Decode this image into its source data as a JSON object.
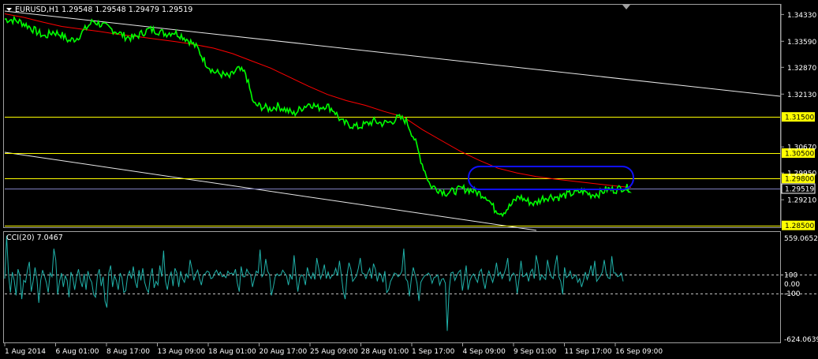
{
  "window": {
    "header": "EURUSD,H1  1.29548 1.29548 1.29479 1.29519",
    "cci_header": "CCI(20) 7.0467"
  },
  "colors": {
    "background": "#000000",
    "frame": "#a0a0a0",
    "price": "#00ff00",
    "ma": "#ff0000",
    "trend": "#e8e8e8",
    "hline": "#ffff00",
    "bid": "#8080c0",
    "highlight": "#1010ff",
    "cci": "#20b2aa",
    "label_bg": "#ffff00",
    "label_text": "#000000",
    "axis_text": "#ffffff"
  },
  "chart_data": [
    {
      "type": "line",
      "title": "EURUSD,H1",
      "ylim": [
        1.2845,
        1.346
      ],
      "y_ticks": [
        "1.34330",
        "1.33590",
        "1.32870",
        "1.32130",
        "1.30670",
        "1.29950",
        "1.29210"
      ],
      "price_labels": [
        "1.31500",
        "1.30500",
        "1.29800",
        "1.29519",
        "1.28500"
      ],
      "x_labels": [
        "1 Aug 2014",
        "6 Aug 01:00",
        "8 Aug 17:00",
        "13 Aug 09:00",
        "18 Aug 01:00",
        "20 Aug 17:00",
        "25 Aug 09:00",
        "28 Aug 01:00",
        "1 Sep 17:00",
        "4 Sep 09:00",
        "9 Sep 01:00",
        "11 Sep 17:00",
        "16 Sep 09:00"
      ],
      "series": [
        {
          "kind": "price",
          "values": [
            1.342,
            1.3418,
            1.3412,
            1.34,
            1.3385,
            1.3372,
            1.3385,
            1.3378,
            1.336,
            1.3368,
            1.3392,
            1.3415,
            1.3405,
            1.3395,
            1.3385,
            1.3372,
            1.3368,
            1.338,
            1.3392,
            1.3388,
            1.338,
            1.3385,
            1.3375,
            1.336,
            1.334,
            1.33,
            1.3275,
            1.3268,
            1.326,
            1.3282,
            1.327,
            1.3185,
            1.3178,
            1.3172,
            1.318,
            1.317,
            1.3158,
            1.3175,
            1.3188,
            1.3175,
            1.3182,
            1.3168,
            1.3135,
            1.3128,
            1.3122,
            1.313,
            1.3138,
            1.3132,
            1.3135,
            1.3148,
            1.314,
            1.309,
            1.302,
            1.296,
            1.295,
            1.294,
            1.2945,
            1.2952,
            1.2948,
            1.294,
            1.293,
            1.2895,
            1.2885,
            1.2905,
            1.293,
            1.2918,
            1.291,
            1.2925,
            1.293,
            1.2928,
            1.2935,
            1.294,
            1.2945,
            1.2935,
            1.2938,
            1.295,
            1.2948,
            1.2955,
            1.2952
          ]
        },
        {
          "kind": "moving-average",
          "values": [
            1.3435,
            1.3425,
            1.3412,
            1.34,
            1.3393,
            1.3386,
            1.3378,
            1.3372,
            1.3365,
            1.3358,
            1.335,
            1.334,
            1.3325,
            1.3305,
            1.3285,
            1.326,
            1.3235,
            1.3212,
            1.3195,
            1.3182,
            1.3165,
            1.315,
            1.3115,
            1.3085,
            1.3055,
            1.303,
            1.3008,
            1.2995,
            1.2985,
            1.2978,
            1.2972,
            1.2966,
            1.296,
            1.2955
          ]
        },
        {
          "kind": "horizontal-levels",
          "values": [
            1.315,
            1.305,
            1.298,
            1.285
          ]
        },
        {
          "kind": "bid",
          "values": [
            1.29519
          ]
        }
      ]
    },
    {
      "type": "line",
      "title": "CCI(20) 7.0467",
      "ylim": [
        -624.0639,
        559.0652
      ],
      "y_ticks": [
        "559.0652",
        "100",
        "0.00",
        "-100",
        "-624.0639"
      ],
      "series": [
        {
          "kind": "cci",
          "values": [
            60,
            520,
            110,
            -90,
            130,
            40,
            -120,
            160,
            90,
            -160,
            40,
            20,
            150,
            240,
            -80,
            30,
            180,
            60,
            -200,
            40,
            150,
            90,
            20,
            -90,
            120,
            80,
            380,
            260,
            -110,
            30,
            120,
            -30,
            90,
            40,
            -140,
            130,
            70,
            -60,
            80,
            160,
            40,
            -30,
            110,
            -60,
            140,
            60,
            20,
            -110,
            -140,
            90,
            160,
            -20,
            80,
            -180,
            -250,
            120,
            200,
            -30,
            90,
            40,
            -60,
            120,
            70,
            -90,
            -70,
            90,
            140,
            60,
            190,
            30,
            -40,
            150,
            40,
            170,
            20,
            -50,
            -90,
            80,
            170,
            -40,
            30,
            -10,
            200,
            80,
            360,
            30,
            -60,
            80,
            130,
            -20,
            170,
            120,
            -30,
            140,
            60,
            20,
            110,
            70,
            260,
            160,
            40,
            110,
            150,
            60,
            -10,
            100,
            110,
            140,
            130,
            60,
            70,
            120,
            150,
            100,
            130,
            80,
            90,
            70,
            140,
            110,
            120,
            100,
            160,
            10,
            -80,
            190,
            80,
            80,
            160,
            120,
            100,
            -30,
            60,
            140,
            120,
            370,
            80,
            110,
            270,
            140,
            100,
            -120,
            -30,
            80,
            110,
            90,
            100,
            150,
            120,
            90,
            -10,
            100,
            50,
            310,
            90,
            -80,
            70,
            100,
            80,
            -10,
            180,
            100,
            60,
            120,
            50,
            280,
            170,
            60,
            120,
            210,
            60,
            130,
            60,
            90,
            100,
            170,
            90,
            250,
            90,
            -80,
            -160,
            100,
            230,
            160,
            30,
            60,
            90,
            170,
            280,
            120,
            110,
            60,
            120,
            170,
            60,
            220,
            160,
            30,
            120,
            100,
            20,
            140,
            -90,
            -60,
            30,
            70,
            120,
            110,
            80,
            100,
            140,
            380,
            60,
            30,
            -130,
            60,
            180,
            100,
            10,
            -180,
            20,
            60,
            90,
            100,
            120,
            90,
            10,
            70,
            80,
            100,
            -10,
            50,
            60,
            10,
            -500,
            -60,
            120,
            130,
            40,
            90,
            130,
            150,
            -70,
            60,
            200,
            -60,
            40,
            90,
            110,
            60,
            20,
            130,
            160,
            40,
            -50,
            80,
            140,
            80,
            20,
            100,
            230,
            90,
            130,
            60,
            110,
            180,
            280,
            30,
            90,
            120,
            90,
            -100,
            60,
            250,
            80,
            90,
            120,
            30,
            130,
            160,
            60,
            310,
            210,
            40,
            100,
            70,
            50,
            260,
            150,
            80,
            60,
            200,
            310,
            80,
            30,
            -110,
            180,
            70,
            90,
            140,
            60,
            80,
            100,
            20,
            60,
            -30,
            40,
            130,
            50,
            110,
            200,
            90,
            250,
            30,
            60,
            90,
            130,
            260,
            120,
            70,
            60,
            300,
            120,
            120,
            80,
            90,
            120,
            30
          ]
        }
      ]
    }
  ]
}
